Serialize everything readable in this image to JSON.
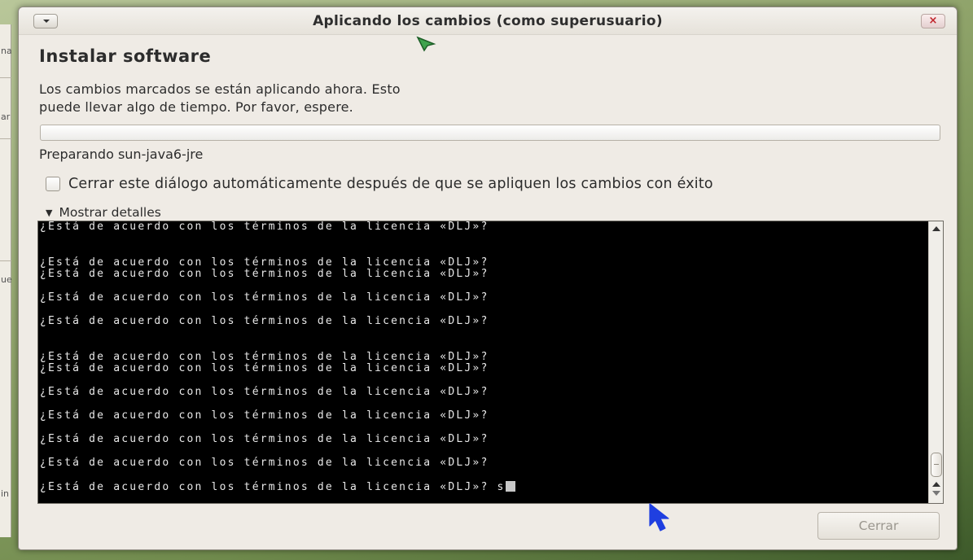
{
  "background_app": {
    "fragments": [
      "na",
      "ar",
      "ue",
      "in"
    ]
  },
  "window": {
    "title": "Aplicando los cambios (como superusuario)",
    "close_symbol": "×"
  },
  "dialog": {
    "heading": "Instalar software",
    "description_line1": "Los cambios marcados se están aplicando ahora. Esto",
    "description_line2": "puede llevar algo de tiempo. Por favor, espere.",
    "progress_fraction": 0,
    "status": "Preparando sun-java6-jre",
    "auto_close_label": "Cerrar este diálogo automáticamente después de que se apliquen los cambios con éxito",
    "auto_close_checked": false,
    "details_arrow": "▼",
    "details_label": "Mostrar detalles",
    "terminal_lines": [
      "¿Está de acuerdo con los términos de la licencia «DLJ»?",
      "",
      "",
      "¿Está de acuerdo con los términos de la licencia «DLJ»?",
      "¿Está de acuerdo con los términos de la licencia «DLJ»?",
      "",
      "¿Está de acuerdo con los términos de la licencia «DLJ»?",
      "",
      "¿Está de acuerdo con los términos de la licencia «DLJ»?",
      "",
      "",
      "¿Está de acuerdo con los términos de la licencia «DLJ»?",
      "¿Está de acuerdo con los términos de la licencia «DLJ»?",
      "",
      "¿Está de acuerdo con los términos de la licencia «DLJ»?",
      "",
      "¿Está de acuerdo con los términos de la licencia «DLJ»?",
      "",
      "¿Está de acuerdo con los términos de la licencia «DLJ»?",
      "",
      "¿Está de acuerdo con los términos de la licencia «DLJ»?",
      ""
    ],
    "terminal_last_line": "¿Está de acuerdo con los términos de la licencia «DLJ»? s",
    "close_button_label": "Cerrar"
  },
  "colors": {
    "terminal_bg": "#000000",
    "terminal_fg": "#e8e8e8",
    "close_accent": "#c0232b",
    "pointer_green": "#3fa34d",
    "pointer_blue": "#1f3fe0"
  },
  "icons": {
    "window_menu": "chevron-down-icon",
    "close": "close-icon",
    "pointer_green": "mouse-pointer-icon",
    "pointer_blue": "mouse-pointer-icon"
  }
}
